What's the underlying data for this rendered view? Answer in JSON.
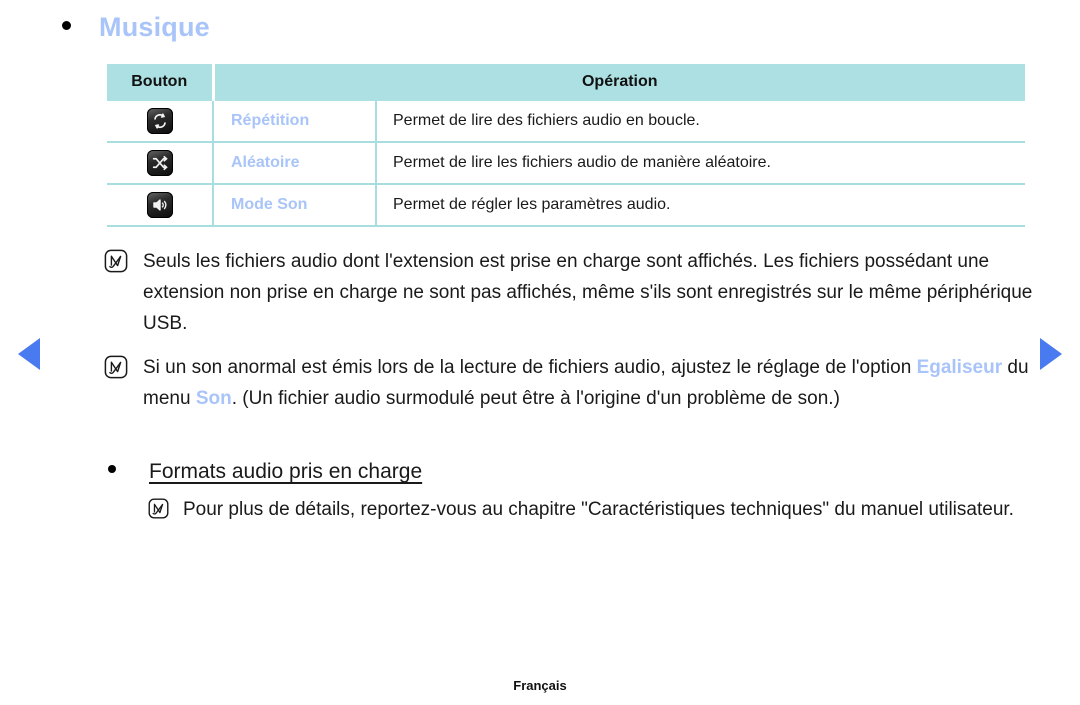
{
  "page": {
    "title": "Musique",
    "footer": "Français",
    "accent_heading_color": "#a8c4f8",
    "table_header_color": "#ade0e2",
    "nav_arrow_color": "#4a7af0"
  },
  "nav": {
    "prev_label": "prev-page-arrow",
    "next_label": "next-page-arrow"
  },
  "table": {
    "columns": [
      "Bouton",
      "Opération"
    ],
    "rows": [
      {
        "icon": "repeat-icon",
        "name": "Répétition",
        "description": "Permet de lire des fichiers audio en boucle."
      },
      {
        "icon": "shuffle-icon",
        "name": "Aléatoire",
        "description": "Permet de lire les fichiers audio de manière aléatoire."
      },
      {
        "icon": "speaker-icon",
        "name": "Mode Son",
        "description": "Permet de régler les paramètres audio."
      }
    ]
  },
  "notes": {
    "formats_support": {
      "icon": "note-pencil-icon",
      "text": "Seuls les fichiers audio dont l'extension est prise en charge sont affichés. Les fichiers possédant une extension non prise en charge ne sont pas affichés, même s'ils sont enregistrés sur le même périphérique USB."
    },
    "abnormal_sound": {
      "icon": "note-pencil-icon",
      "part1": "Si un son anormal est émis lors de la lecture de fichiers audio, ajustez le réglage de l'option ",
      "highlight1": "Egaliseur",
      "part2": " du menu ",
      "highlight2": "Son",
      "part3": ". (Un fichier audio surmodulé peut être à l'origine d'un problème de son.)"
    },
    "specs_ref": {
      "icon": "note-pencil-icon",
      "text": "Pour plus de détails, reportez-vous au chapitre \"Caractéristiques techniques\" du manuel utilisateur."
    }
  },
  "sub_heading": {
    "label": "Formats audio pris en charge"
  }
}
